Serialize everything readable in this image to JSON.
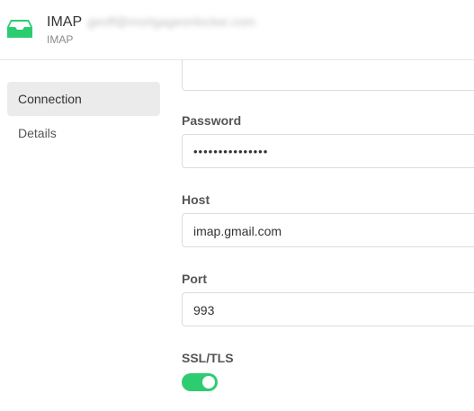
{
  "header": {
    "title": "IMAP",
    "account": "geoff@mortgageonlocker.com",
    "subtitle": "IMAP",
    "icon": "inbox-tray-icon",
    "icon_color": "#2ecc71"
  },
  "sidebar": {
    "items": [
      {
        "label": "Connection",
        "active": true
      },
      {
        "label": "Details",
        "active": false
      }
    ]
  },
  "form": {
    "password": {
      "label": "Password",
      "value": "•••••••••••••••"
    },
    "host": {
      "label": "Host",
      "value": "imap.gmail.com"
    },
    "port": {
      "label": "Port",
      "value": "993"
    },
    "ssl": {
      "label": "SSL/TLS",
      "enabled": true,
      "color": "#2ecc71"
    }
  }
}
